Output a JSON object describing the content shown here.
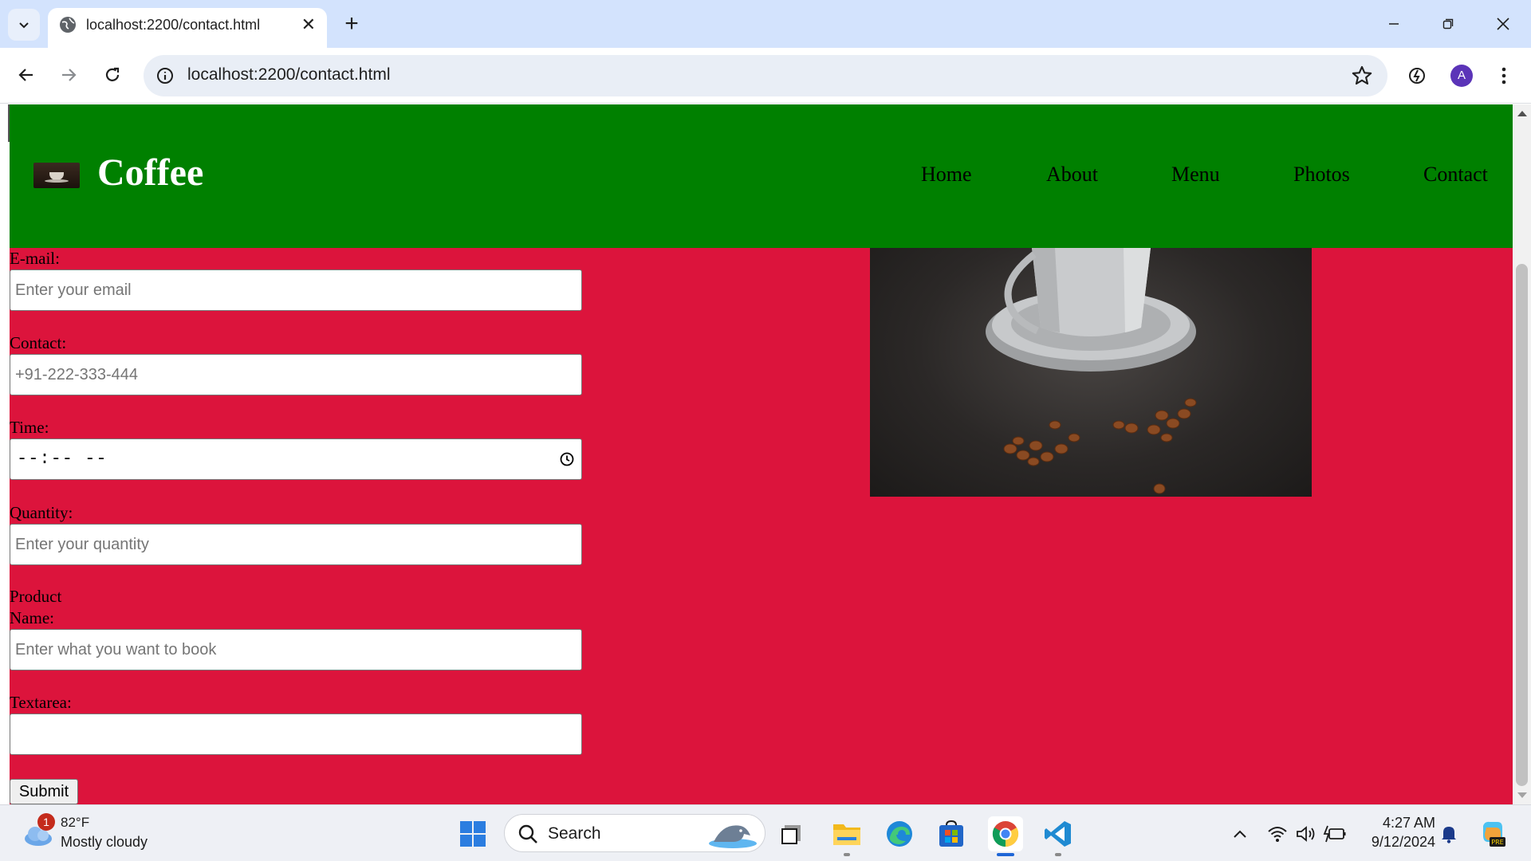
{
  "browser": {
    "tab_title": "localhost:2200/contact.html",
    "url": "localhost:2200/contact.html",
    "profile_initial": "A"
  },
  "site": {
    "title": "Coffee",
    "nav": [
      "Home",
      "About",
      "Menu",
      "Photos",
      "Contact"
    ],
    "colors": {
      "header": "#008000",
      "background": "#dc143c"
    }
  },
  "form": {
    "email_label": "E-mail:",
    "email_placeholder": "Enter your email",
    "contact_label": "Contact:",
    "contact_placeholder": "+91-222-333-444",
    "time_label": "Time:",
    "time_value": "--:-- --",
    "quantity_label": "Quantity:",
    "quantity_placeholder": "Enter your quantity",
    "product_label_line1": "Product",
    "product_label_line2": "Name:",
    "product_placeholder": "Enter what you want to book",
    "textarea_label": "Textarea:",
    "submit_label": "Submit"
  },
  "taskbar": {
    "weather_temp": "82°F",
    "weather_condition": "Mostly cloudy",
    "weather_badge": "1",
    "search_label": "Search",
    "time": "4:27 AM",
    "date": "9/12/2024"
  }
}
